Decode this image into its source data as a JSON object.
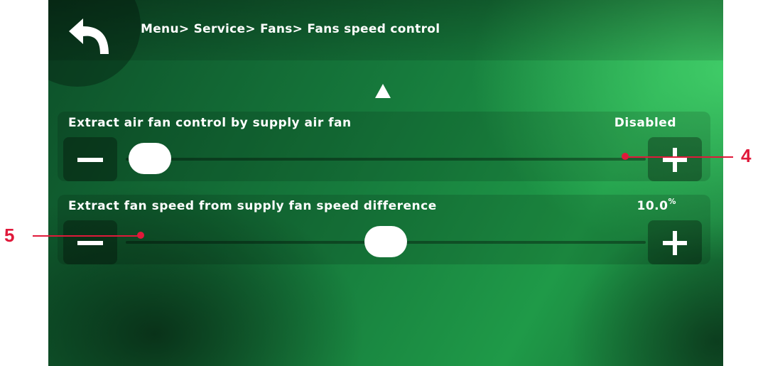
{
  "breadcrumb": "Menu> Service> Fans> Fans speed control",
  "rows": [
    {
      "label": "Extract air fan control by supply air fan",
      "value": "Disabled",
      "unit": "",
      "slider_fraction": 0.0,
      "minus_label": "−",
      "plus_label": "+"
    },
    {
      "label": "Extract fan speed from supply fan speed difference",
      "value": "10.0",
      "unit": "%",
      "slider_fraction": 0.5,
      "minus_label": "−",
      "plus_label": "+"
    }
  ],
  "callouts": [
    {
      "number": "4",
      "target": "extract-air-fan-slider"
    },
    {
      "number": "5",
      "target": "fan-speed-difference-slider"
    }
  ],
  "icons": {
    "back": "back-arrow-icon",
    "scroll_up": "triangle-up-icon"
  },
  "colors": {
    "accent_callout": "#e0193a",
    "screen_green": "#167a3c"
  }
}
